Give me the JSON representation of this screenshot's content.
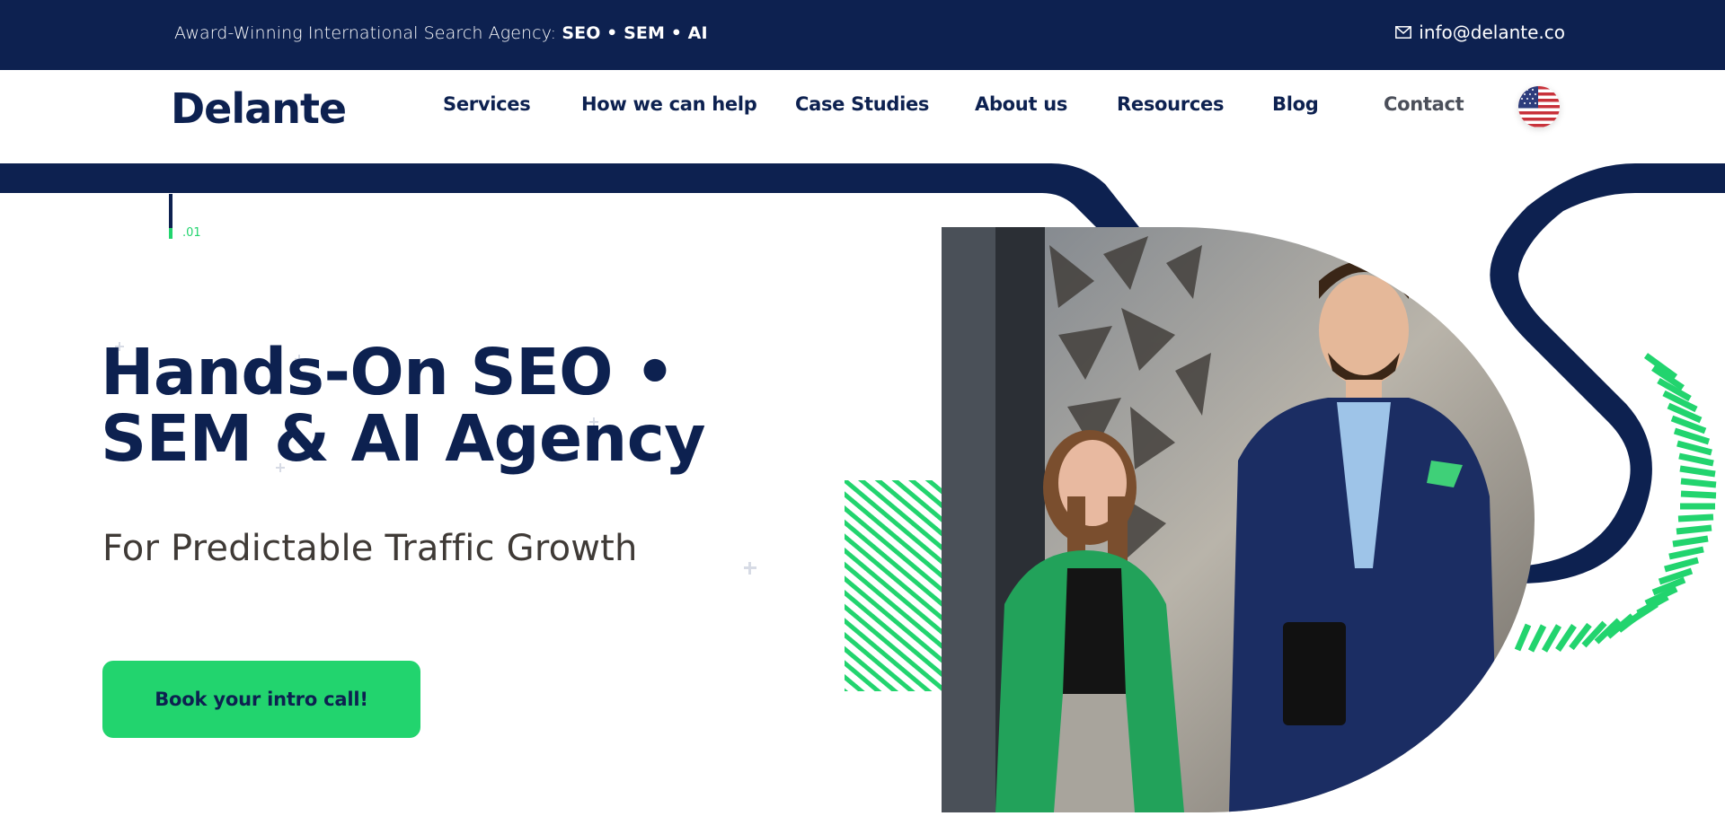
{
  "topbar": {
    "tagline_prefix": "Award-Winning International Search Agency:",
    "tagline_services": "SEO • SEM • AI",
    "email": "info@delante.co",
    "email_icon": "envelope-icon"
  },
  "navbar": {
    "logo": "Delante",
    "items": [
      {
        "label": "Services"
      },
      {
        "label": "How we can help"
      },
      {
        "label": "Case Studies"
      },
      {
        "label": "About us"
      },
      {
        "label": "Resources"
      },
      {
        "label": "Blog"
      },
      {
        "label": "Contact"
      }
    ],
    "language_icon": "us-flag-icon"
  },
  "hero": {
    "slide_number": ".01",
    "title_line1": "Hands-On SEO •",
    "title_line2": "SEM & AI Agency",
    "subtitle": "For Predictable Traffic Growth",
    "cta_label": "Book your intro call!"
  },
  "colors": {
    "navy": "#0d2150",
    "green": "#22d46e",
    "white": "#ffffff"
  }
}
